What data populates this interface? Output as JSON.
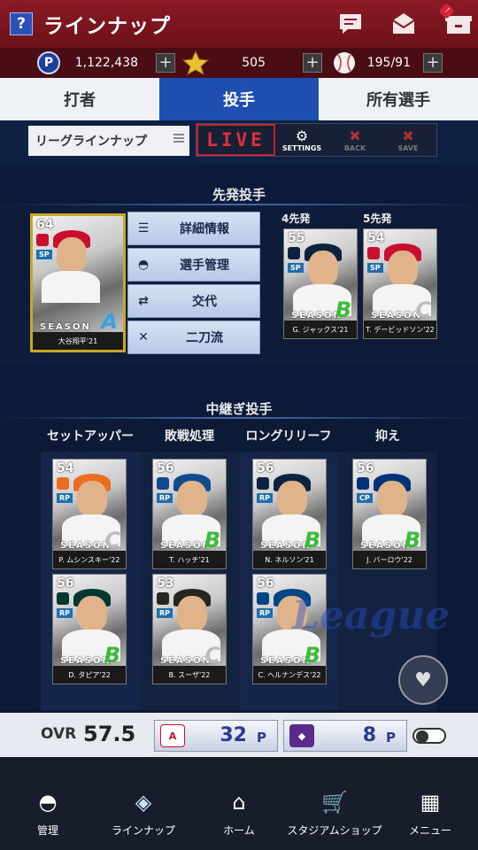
{
  "header": {
    "help_label": "?",
    "title": "ラインナップ",
    "icons": [
      "chat-icon",
      "mail-icon",
      "gift-box-icon"
    ],
    "notification_badge": "!"
  },
  "currency": {
    "points_icon_label": "P",
    "points": "1,122,438",
    "stars": "505",
    "balls": "195/91",
    "plus_label": "+"
  },
  "tabs": [
    {
      "label": "打者",
      "active": false
    },
    {
      "label": "投手",
      "active": true
    },
    {
      "label": "所有選手",
      "active": false
    }
  ],
  "toolbar": {
    "league_lineup": "リーグラインナップ",
    "live": "LIVE",
    "settings": "SETTINGS",
    "back": "BACK",
    "save": "SAVE"
  },
  "starters": {
    "section_title": "先発投手",
    "slot4": "4先発",
    "slot5": "5先発",
    "cards": [
      {
        "ovr": "64",
        "pos": "SP",
        "season": "SEASON",
        "grade": "A",
        "name": "大谷翔平'21",
        "team_color": "#c8102e"
      },
      {
        "ovr": "55",
        "pos": "SP",
        "season": "SEASON",
        "grade": "B",
        "name": "G. ジャックス'21",
        "team_color": "#0c2340"
      },
      {
        "ovr": "54",
        "pos": "SP",
        "season": "SEASON",
        "grade": "C",
        "name": "T. デービッドソン'22",
        "team_color": "#c8102e"
      }
    ]
  },
  "context_menu": [
    {
      "label": "詳細情報",
      "icon": "person-list-icon"
    },
    {
      "label": "選手管理",
      "icon": "cap-icon"
    },
    {
      "label": "交代",
      "icon": "swap-icon"
    },
    {
      "label": "二刀流",
      "icon": "crossed-bats-icon"
    }
  ],
  "relief": {
    "section_title": "中継ぎ投手",
    "columns": [
      "セットアッパー",
      "敗戦処理",
      "ロングリリーフ",
      "抑え"
    ],
    "cards": [
      {
        "ovr": "54",
        "pos": "RP",
        "season": "SEASON",
        "grade": "C",
        "name": "P. ムシンスキー'22",
        "team_color": "#eb6e1f"
      },
      {
        "ovr": "56",
        "pos": "RP",
        "season": "SEASON",
        "grade": "B",
        "name": "T. ハッチ'21",
        "team_color": "#134a8e"
      },
      {
        "ovr": "56",
        "pos": "RP",
        "season": "SEASON",
        "grade": "B",
        "name": "N. ネルソン'21",
        "team_color": "#0c2340"
      },
      {
        "ovr": "56",
        "pos": "CP",
        "season": "SEASON",
        "grade": "B",
        "name": "J. バーロウ'22",
        "team_color": "#003278"
      },
      {
        "ovr": "56",
        "pos": "RP",
        "season": "SEASON",
        "grade": "B",
        "name": "D. タピア'22",
        "team_color": "#003831"
      },
      {
        "ovr": "53",
        "pos": "RP",
        "season": "SEASON",
        "grade": "C",
        "name": "B. スーザ'22",
        "team_color": "#27251f"
      },
      {
        "ovr": "56",
        "pos": "RP",
        "season": "SEASON",
        "grade": "B",
        "name": "C. ヘルナンデス'22",
        "team_color": "#004687"
      }
    ]
  },
  "watermark": "League",
  "stats": {
    "ovr_label": "OVR",
    "ovr_value": "57.5",
    "team1_points": "32",
    "team2_points": "8",
    "unit": "P",
    "toggle_on": false
  },
  "nav": [
    {
      "label": "管理",
      "icon": "cap-icon",
      "active": false
    },
    {
      "label": "ラインナップ",
      "icon": "diamond-icon",
      "active": true
    },
    {
      "label": "ホーム",
      "icon": "home-icon",
      "active": false
    },
    {
      "label": "スタジアムショップ",
      "icon": "cart-icon",
      "active": false
    },
    {
      "label": "メニュー",
      "icon": "grid-icon",
      "active": false
    }
  ]
}
